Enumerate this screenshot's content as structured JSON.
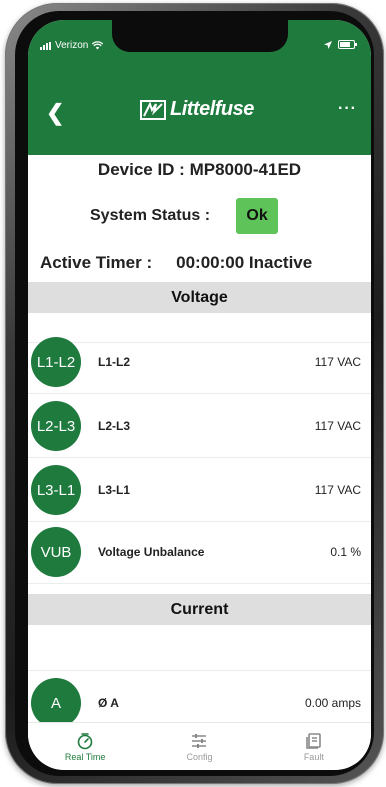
{
  "status_bar": {
    "carrier": "Verizon"
  },
  "header": {
    "brand": "Littelfuse",
    "more_label": "···"
  },
  "device": {
    "id_label": "Device ID : MP8000-41ED"
  },
  "system_status": {
    "label": "System Status :",
    "value": "Ok"
  },
  "active_timer": {
    "label": "Active Timer :",
    "value": "00:00:00 Inactive"
  },
  "sections": {
    "voltage": "Voltage",
    "current": "Current"
  },
  "voltage_rows": [
    {
      "badge": "L1-L2",
      "label": "L1-L2",
      "value": "117 VAC"
    },
    {
      "badge": "L2-L3",
      "label": "L2-L3",
      "value": "117 VAC"
    },
    {
      "badge": "L3-L1",
      "label": "L3-L1",
      "value": "117 VAC"
    },
    {
      "badge": "VUB",
      "label": "Voltage Unbalance",
      "value": "0.1 %"
    }
  ],
  "current_rows": [
    {
      "badge": "A",
      "label": "Ø A",
      "value": "0.00 amps"
    }
  ],
  "tabs": [
    {
      "label": "Real Time",
      "icon": "gauge-icon",
      "active": true
    },
    {
      "label": "Config",
      "icon": "sliders-icon",
      "active": false
    },
    {
      "label": "Fault",
      "icon": "document-icon",
      "active": false
    }
  ],
  "colors": {
    "brand_green": "#1f7a3e",
    "status_ok": "#5ec358",
    "section_bg": "#dedede"
  }
}
